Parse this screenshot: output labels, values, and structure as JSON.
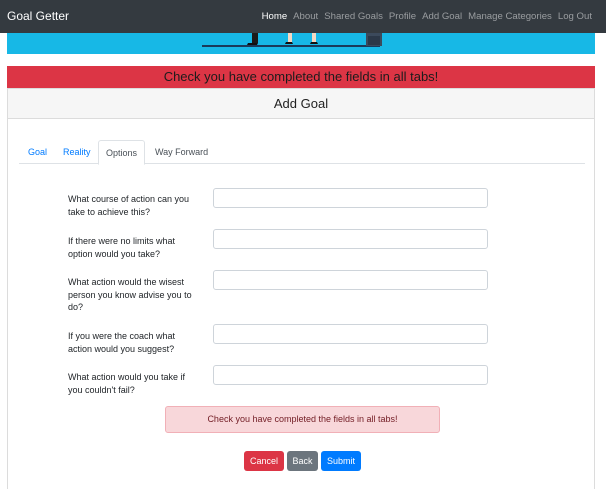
{
  "navbar": {
    "brand": "Goal Getter",
    "links": [
      {
        "label": "Home",
        "active": true
      },
      {
        "label": "About"
      },
      {
        "label": "Shared Goals"
      },
      {
        "label": "Profile"
      },
      {
        "label": "Add Goal"
      },
      {
        "label": "Manage Categories"
      },
      {
        "label": "Log Out"
      }
    ]
  },
  "alert_top": "Check you have completed the fields in all tabs!",
  "card": {
    "title": "Add Goal",
    "tabs": [
      "Goal",
      "Reality",
      "Options",
      "Way Forward"
    ],
    "active_tab": "Options",
    "questions": [
      {
        "label": "What course of action can you take to achieve this?",
        "value": ""
      },
      {
        "label": "If there were no limits what option would you take?",
        "value": ""
      },
      {
        "label": "What action would the wisest person you know advise you to do?",
        "value": ""
      },
      {
        "label": "If you were the coach what action would you suggest?",
        "value": ""
      },
      {
        "label": "What action would you take if you couldn't fail?",
        "value": ""
      }
    ],
    "alert_bottom": "Check you have completed the fields in all tabs!",
    "buttons": {
      "cancel": "Cancel",
      "back": "Back",
      "submit": "Submit"
    }
  },
  "colors": {
    "navbar": "#343a40",
    "hero": "#17b8e6",
    "danger": "#dc3545",
    "secondary": "#6c757d",
    "primary": "#007bff",
    "alert_bg": "#f8d7da"
  }
}
